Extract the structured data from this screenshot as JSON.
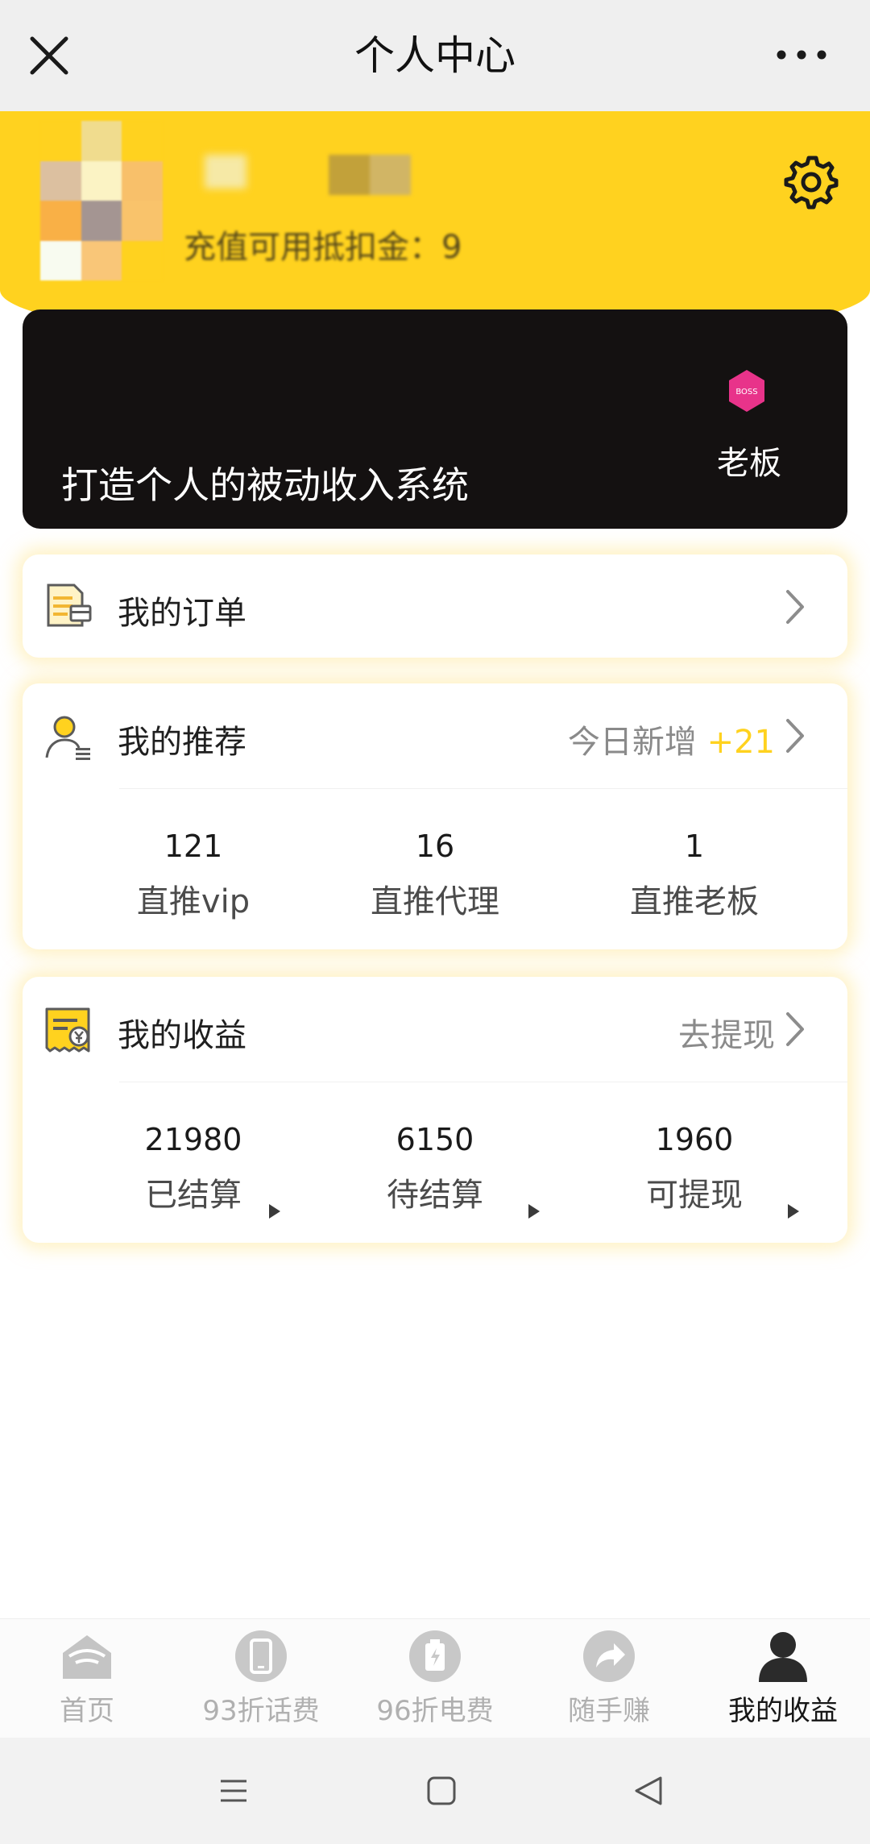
{
  "navbar": {
    "title": "个人中心",
    "close_icon": "close-icon",
    "more_icon": "more-dots-icon"
  },
  "header": {
    "balance_text": "充值可用抵扣金：9",
    "settings_icon": "gear-icon",
    "accent_color": "#ffd21f"
  },
  "banner": {
    "slogan": "打造个人的被动收入系统",
    "badge_text": "BOSS",
    "level_label": "老板"
  },
  "orders": {
    "title": "我的订单",
    "icon": "document-icon"
  },
  "referrals": {
    "title": "我的推荐",
    "icon": "user-icon",
    "today_label": "今日新增",
    "today_value": "+21",
    "stats": [
      {
        "value": "121",
        "label": "直推vip"
      },
      {
        "value": "16",
        "label": "直推代理"
      },
      {
        "value": "1",
        "label": "直推老板"
      }
    ]
  },
  "earnings": {
    "title": "我的收益",
    "icon": "receipt-icon",
    "withdraw_label": "去提现",
    "stats": [
      {
        "value": "21980",
        "label": "已结算"
      },
      {
        "value": "6150",
        "label": "待结算"
      },
      {
        "value": "1960",
        "label": "可提现"
      }
    ]
  },
  "tabbar": {
    "tabs": [
      {
        "label": "首页",
        "icon": "home-icon"
      },
      {
        "label": "93折话费",
        "icon": "phone-icon"
      },
      {
        "label": "96折电费",
        "icon": "battery-icon"
      },
      {
        "label": "随手赚",
        "icon": "share-icon"
      },
      {
        "label": "我的收益",
        "icon": "person-icon"
      }
    ],
    "active_index": 4
  },
  "system_bar": {
    "buttons": [
      "menu-icon",
      "home-square-icon",
      "back-triangle-icon"
    ]
  }
}
